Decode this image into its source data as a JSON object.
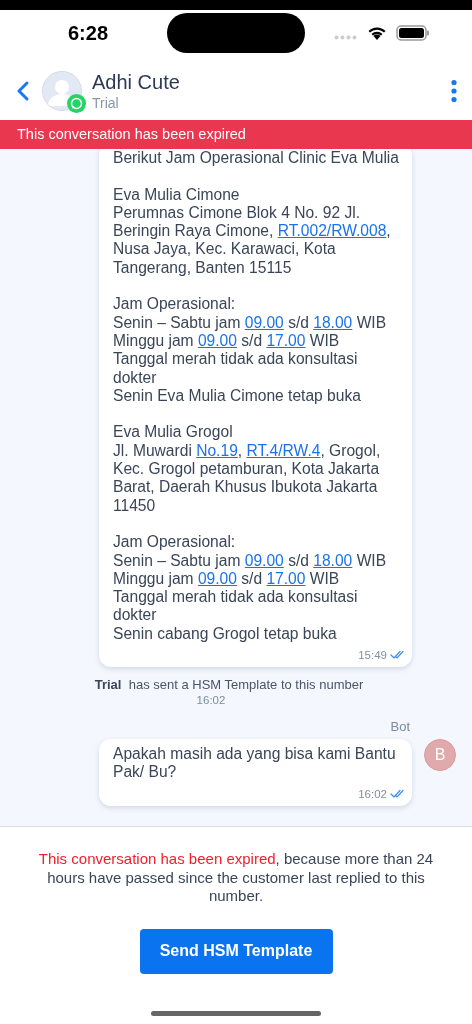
{
  "status_bar": {
    "time": "6:28"
  },
  "header": {
    "name": "Adhi Cute",
    "subtitle": "Trial"
  },
  "banner": {
    "text": "This conversation has been expired"
  },
  "messages": [
    {
      "kind": "bubble",
      "paragraphs": [
        [
          [
            {
              "kind": "text",
              "text": "Berikut Jam Operasional Clinic Eva Mulia"
            }
          ]
        ],
        [
          [
            {
              "kind": "text",
              "text": "Eva Mulia Cimone"
            }
          ],
          [
            {
              "kind": "text",
              "text": "Perumnas Cimone Blok 4 No. 92 Jl."
            }
          ],
          [
            {
              "kind": "text",
              "text": "Beringin Raya Cimone, "
            },
            {
              "kind": "link",
              "text": "RT.002/RW.008"
            },
            {
              "kind": "text",
              "text": ","
            }
          ],
          [
            {
              "kind": "text",
              "text": "Nusa Jaya, Kec. Karawaci, Kota"
            }
          ],
          [
            {
              "kind": "text",
              "text": "Tangerang, Banten 15115"
            }
          ]
        ],
        [
          [
            {
              "kind": "text",
              "text": "Jam Operasional:"
            }
          ],
          [
            {
              "kind": "text",
              "text": "Senin – Sabtu jam "
            },
            {
              "kind": "link",
              "text": "09.00"
            },
            {
              "kind": "text",
              "text": " s/d "
            },
            {
              "kind": "link",
              "text": "18.00"
            },
            {
              "kind": "text",
              "text": " WIB"
            }
          ],
          [
            {
              "kind": "text",
              "text": "Minggu jam "
            },
            {
              "kind": "link",
              "text": "09.00"
            },
            {
              "kind": "text",
              "text": " s/d "
            },
            {
              "kind": "link",
              "text": "17.00"
            },
            {
              "kind": "text",
              "text": " WIB"
            }
          ],
          [
            {
              "kind": "text",
              "text": "Tanggal merah tidak ada konsultasi"
            }
          ],
          [
            {
              "kind": "text",
              "text": "dokter"
            }
          ],
          [
            {
              "kind": "text",
              "text": "Senin Eva Mulia Cimone tetap buka"
            }
          ]
        ],
        [
          [
            {
              "kind": "text",
              "text": "Eva Mulia Grogol"
            }
          ],
          [
            {
              "kind": "text",
              "text": "Jl. Muwardi "
            },
            {
              "kind": "link",
              "text": "No.19"
            },
            {
              "kind": "text",
              "text": ", "
            },
            {
              "kind": "link",
              "text": "RT.4/RW.4"
            },
            {
              "kind": "text",
              "text": ", Grogol,"
            }
          ],
          [
            {
              "kind": "text",
              "text": "Kec. Grogol petamburan, Kota Jakarta"
            }
          ],
          [
            {
              "kind": "text",
              "text": "Barat, Daerah Khusus Ibukota Jakarta"
            }
          ],
          [
            {
              "kind": "text",
              "text": "11450"
            }
          ]
        ],
        [
          [
            {
              "kind": "text",
              "text": "Jam Operasional:"
            }
          ],
          [
            {
              "kind": "text",
              "text": "Senin – Sabtu jam "
            },
            {
              "kind": "link",
              "text": "09.00"
            },
            {
              "kind": "text",
              "text": " s/d "
            },
            {
              "kind": "link",
              "text": "18.00"
            },
            {
              "kind": "text",
              "text": " WIB"
            }
          ],
          [
            {
              "kind": "text",
              "text": "Minggu jam "
            },
            {
              "kind": "link",
              "text": "09.00"
            },
            {
              "kind": "text",
              "text": " s/d "
            },
            {
              "kind": "link",
              "text": "17.00"
            },
            {
              "kind": "text",
              "text": " WIB"
            }
          ],
          [
            {
              "kind": "text",
              "text": "Tanggal merah tidak ada konsultasi"
            }
          ],
          [
            {
              "kind": "text",
              "text": "dokter"
            }
          ],
          [
            {
              "kind": "text",
              "text": "Senin cabang Grogol tetap buka"
            }
          ]
        ]
      ],
      "time": "15:49",
      "read": true
    },
    {
      "kind": "system",
      "sender": "Trial",
      "text": "has sent a HSM Template to this number",
      "time": "16:02"
    },
    {
      "kind": "bubble",
      "author": "Bot",
      "avatar": "B",
      "paragraphs": [
        [
          [
            {
              "kind": "text",
              "text": "Apakah masih ada yang bisa kami Bantu"
            }
          ],
          [
            {
              "kind": "text",
              "text": "Pak/ Bu?"
            }
          ]
        ]
      ],
      "time": "16:02",
      "read": true
    }
  ],
  "footer": {
    "notice_highlight": "This conversation has been expired",
    "notice_rest": ", because more than 24 hours have passed since the customer last replied to this number.",
    "button": "Send HSM Template"
  }
}
